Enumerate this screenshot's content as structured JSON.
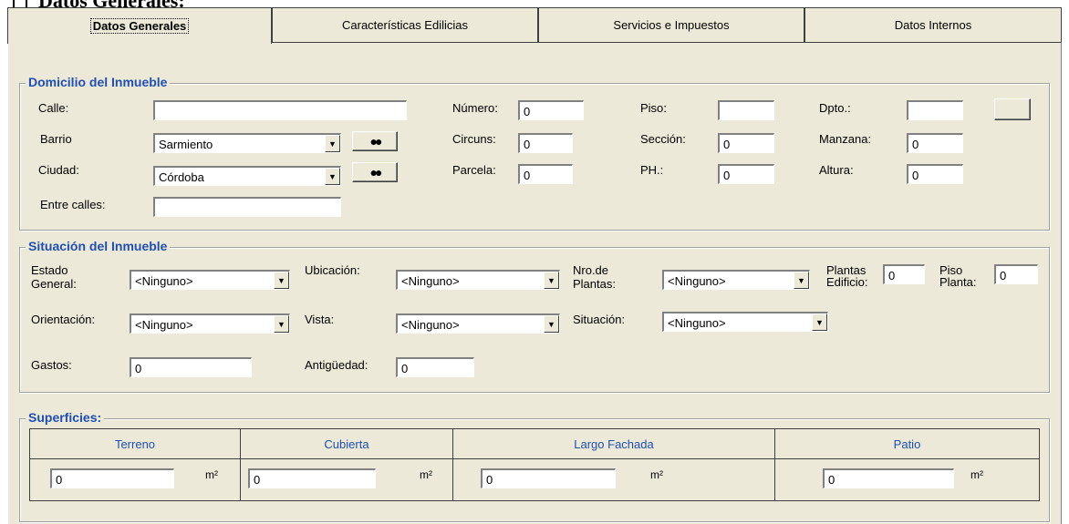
{
  "heading": "Datos Generales:",
  "tabs": [
    "Datos Generales",
    "Características Edilicias",
    "Servicios e Impuestos",
    "Datos Internos"
  ],
  "domicilio": {
    "legend": "Domicilio del Inmueble",
    "calle_label": "Calle:",
    "calle_value": "",
    "numero_label": "Número:",
    "numero_value": "0",
    "piso_label": "Piso:",
    "piso_value": "",
    "dpto_label": "Dpto.:",
    "dpto_value": "",
    "barrio_label": "Barrio",
    "barrio_value": "Sarmiento",
    "circuns_label": "Circuns:",
    "circuns_value": "0",
    "seccion_label": "Sección:",
    "seccion_value": "0",
    "manzana_label": "Manzana:",
    "manzana_value": "0",
    "ciudad_label": "Ciudad:",
    "ciudad_value": "Córdoba",
    "parcela_label": "Parcela:",
    "parcela_value": "0",
    "ph_label": "PH.:",
    "ph_value": "0",
    "altura_label": "Altura:",
    "altura_value": "0",
    "entre_label": "Entre calles:",
    "entre_value": ""
  },
  "situacion": {
    "legend": "Situación del Inmueble",
    "estado_label": [
      "Estado",
      "General:"
    ],
    "estado_value": "<Ninguno>",
    "ubicacion_label": "Ubicación:",
    "ubicacion_value": "<Ninguno>",
    "nro_plantas_label": [
      "Nro.de",
      "Plantas:"
    ],
    "nro_plantas_value": "<Ninguno>",
    "plantas_edificio_label": [
      "Plantas",
      "Edificio:"
    ],
    "plantas_edificio_value": "0",
    "piso_planta_label": [
      "Piso",
      "Planta:"
    ],
    "piso_planta_value": "0",
    "orientacion_label": "Orientación:",
    "orientacion_value": "<Ninguno>",
    "vista_label": "Vista:",
    "vista_value": "<Ninguno>",
    "situacion_label": "Situación:",
    "situacion_value": "<Ninguno>",
    "gastos_label": "Gastos:",
    "gastos_value": "0",
    "antiguedad_label": "Antigüedad:",
    "antiguedad_value": "0"
  },
  "superficies": {
    "legend": "Superficies:",
    "unit": "m²",
    "columns": [
      {
        "header": "Terreno",
        "value": "0"
      },
      {
        "header": "Cubierta",
        "value": "0"
      },
      {
        "header": "Largo Fachada",
        "value": "0"
      },
      {
        "header": "Patio",
        "value": "0"
      }
    ]
  },
  "icons": {
    "dropdown": "chevron-down-icon",
    "search": "binoculars-icon"
  },
  "colors": {
    "legend": "#1f4fb4",
    "panel": "#ece9d8"
  }
}
